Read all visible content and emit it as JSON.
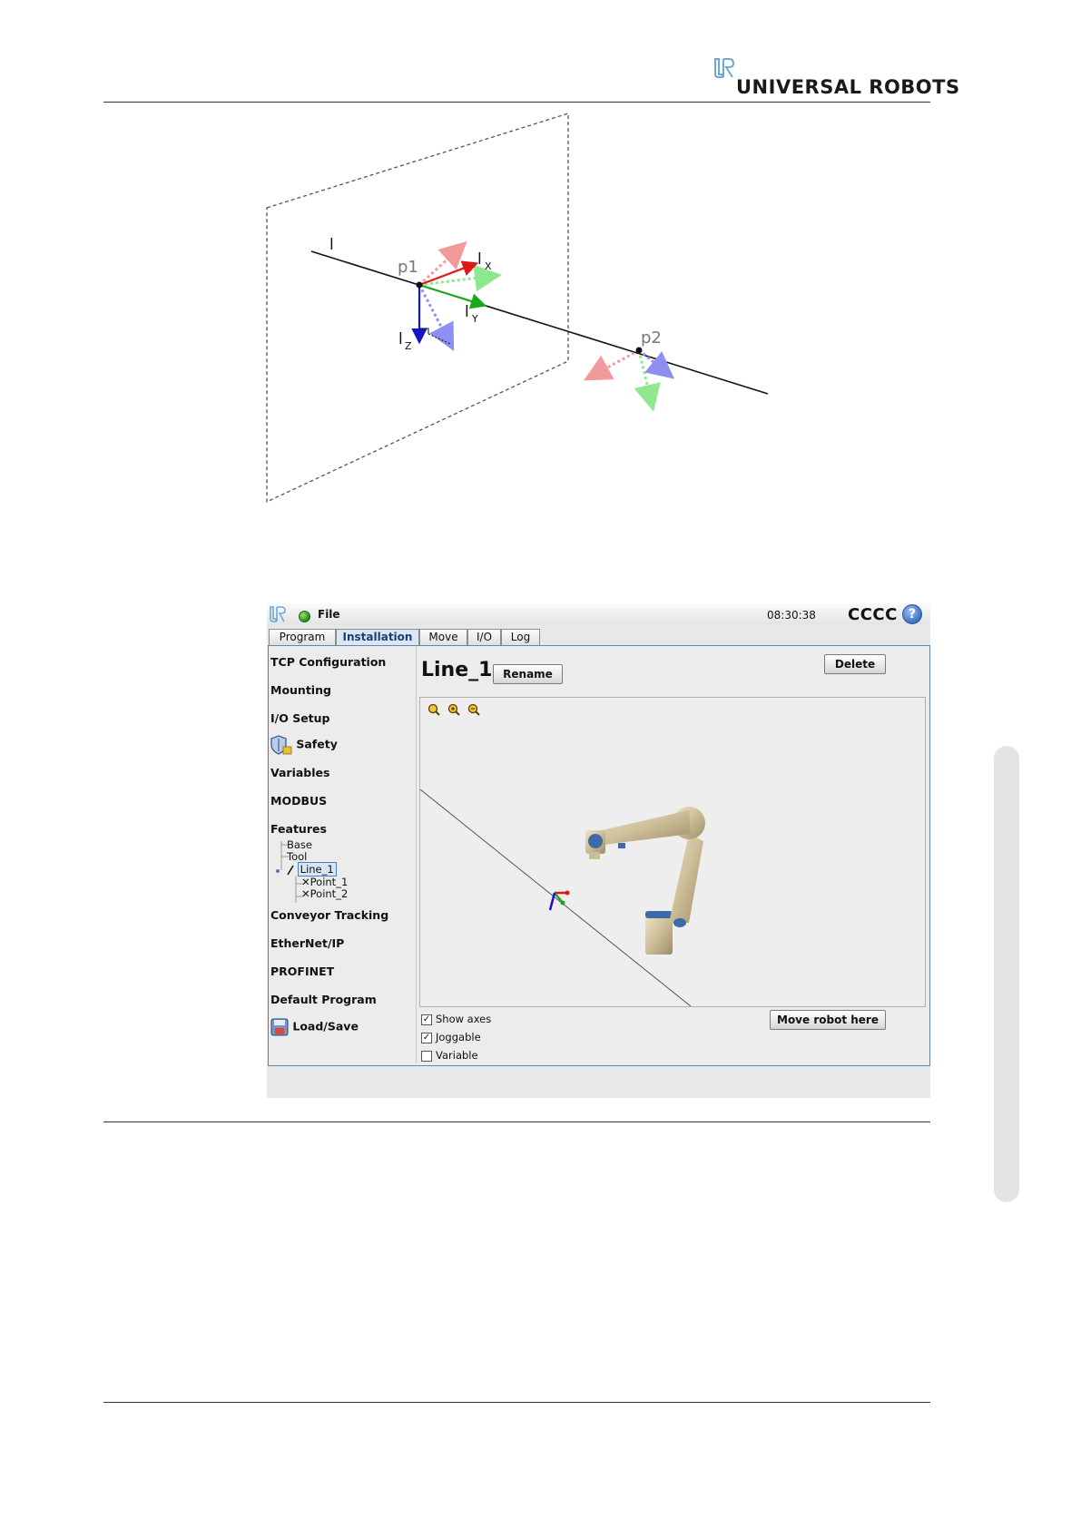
{
  "header": {
    "logo_text": "UNIVERSAL ROBOTS"
  },
  "diagram": {
    "labels": {
      "l": "l",
      "p1": "p1",
      "p2": "p2",
      "lx": "l",
      "lx_sub": "X",
      "ly": "l",
      "ly_sub": "Y",
      "lz": "l",
      "lz_sub": "Z"
    },
    "colors": {
      "x_axis": "#e01818",
      "y_axis": "#1aa81a",
      "z_axis": "#1414c8",
      "x_faded": "#f29a9a",
      "y_faded": "#8fe88f",
      "z_faded": "#8f8ff2"
    }
  },
  "ui": {
    "titlebar": {
      "file_menu": "File",
      "time": "08:30:38",
      "robot_name": "CCCC",
      "help": "?"
    },
    "tabs": [
      {
        "label": "Program",
        "active": false
      },
      {
        "label": "Installation",
        "active": true
      },
      {
        "label": "Move",
        "active": false
      },
      {
        "label": "I/O",
        "active": false
      },
      {
        "label": "Log",
        "active": false
      }
    ],
    "nav": {
      "tcp": "TCP Configuration",
      "mounting": "Mounting",
      "io_setup": "I/O Setup",
      "safety": "Safety",
      "variables": "Variables",
      "modbus": "MODBUS",
      "features": "Features",
      "conveyor": "Conveyor Tracking",
      "ethernet": "EtherNet/IP",
      "profinet": "PROFINET",
      "default_program": "Default Program",
      "load_save": "Load/Save"
    },
    "feature_tree": {
      "base": "Base",
      "tool": "Tool",
      "line": "Line_1",
      "point1": "Point_1",
      "point2": "Point_2"
    },
    "main": {
      "title": "Line_1",
      "rename": "Rename",
      "delete": "Delete",
      "move_robot": "Move robot here",
      "show_axes": "Show axes",
      "joggable": "Joggable",
      "variable": "Variable",
      "show_axes_checked": true,
      "joggable_checked": true,
      "variable_checked": false
    }
  }
}
